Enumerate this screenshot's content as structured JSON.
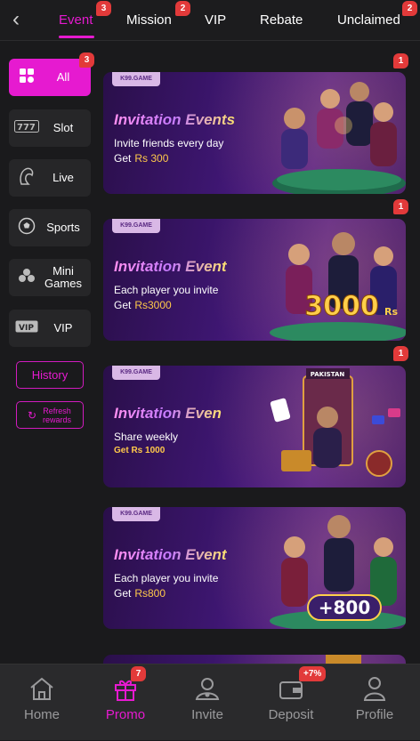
{
  "topbar": {
    "tabs": [
      {
        "label": "Event",
        "badge": "3",
        "active": true
      },
      {
        "label": "Mission",
        "badge": "2"
      },
      {
        "label": "VIP",
        "badge": ""
      },
      {
        "label": "Rebate",
        "badge": ""
      },
      {
        "label": "Unclaimed",
        "badge": "2"
      }
    ]
  },
  "sidebar": {
    "items": [
      {
        "label": "All",
        "icon": "grid-icon",
        "badge": "3",
        "active": true
      },
      {
        "label": "Slot",
        "icon": "slot-777-icon"
      },
      {
        "label": "Live",
        "icon": "dealer-icon"
      },
      {
        "label": "Sports",
        "icon": "soccer-ball-icon"
      },
      {
        "label": "Mini Games",
        "icon": "clubs-icon"
      },
      {
        "label": "VIP",
        "icon": "vip-icon"
      }
    ],
    "history_label": "History",
    "refresh_label": "Refresh rewards"
  },
  "promotions": [
    {
      "brand": "K99.GAME",
      "title": "Invitation Events",
      "subtitle": "Invite friends every day",
      "amount_label": "Get",
      "amount": "Rs 300",
      "badge": "1"
    },
    {
      "brand": "K99.GAME",
      "title": "Invitation Event",
      "subtitle": "Each player you invite",
      "amount_label": "Get",
      "amount": "Rs3000",
      "art_text": "3000",
      "art_unit": "Rs",
      "badge": "1"
    },
    {
      "brand": "K99.GAME",
      "title": "Invitation Even",
      "subtitle": "Share weekly",
      "amount_label": "Get Rs 1000",
      "amount": "",
      "art_text": "PAKISTAN",
      "badge": "1"
    },
    {
      "brand": "K99.GAME",
      "title": "Invitation Event",
      "subtitle": "Each player you invite",
      "amount_label": "Get",
      "amount": "Rs800",
      "art_text": "+800",
      "badge": ""
    }
  ],
  "bottom_nav": [
    {
      "label": "Home",
      "icon": "home-icon"
    },
    {
      "label": "Promo",
      "icon": "gift-icon",
      "badge": "7",
      "active": true
    },
    {
      "label": "Invite",
      "icon": "invite-icon"
    },
    {
      "label": "Deposit",
      "icon": "wallet-icon",
      "badge": "+7%"
    },
    {
      "label": "Profile",
      "icon": "profile-icon"
    }
  ],
  "colors": {
    "accent": "#e61ad0",
    "badge": "#e23a3a",
    "background": "#1a1a1c",
    "gold": "#ffc94a"
  }
}
